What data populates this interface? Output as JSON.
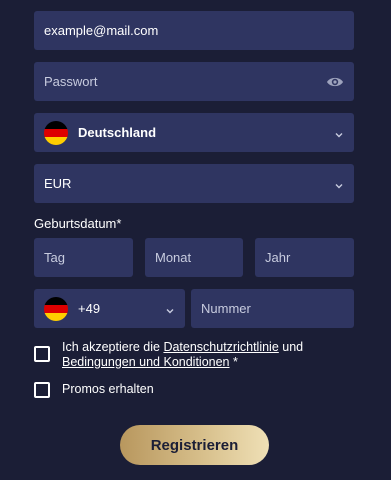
{
  "form": {
    "email": {
      "value": "example@mail.com"
    },
    "password": {
      "placeholder": "Passwort"
    },
    "country": {
      "value": "Deutschland",
      "flag": "germany-flag"
    },
    "currency": {
      "value": "EUR"
    },
    "birthdate": {
      "label": "Geburtsdatum*",
      "day_placeholder": "Tag",
      "month_placeholder": "Monat",
      "year_placeholder": "Jahr"
    },
    "phone": {
      "country_code": "+49",
      "flag": "germany-flag",
      "number_placeholder": "Nummer"
    },
    "terms": {
      "text_before": "Ich akzeptiere die ",
      "privacy_link": "Datenschutzrichtlinie",
      "text_middle": " und",
      "terms_link": "Bedingungen und Konditionen",
      "text_after": " *"
    },
    "promos": {
      "label": "Promos erhalten"
    },
    "submit_label": "Registrieren"
  },
  "colors": {
    "background": "#1b1e36",
    "field": "#2f3561",
    "button_gold_start": "#b8975e",
    "button_gold_end": "#efe0b6"
  },
  "icons": [
    "germany-flag",
    "eye-icon",
    "chevron-down-icon"
  ]
}
